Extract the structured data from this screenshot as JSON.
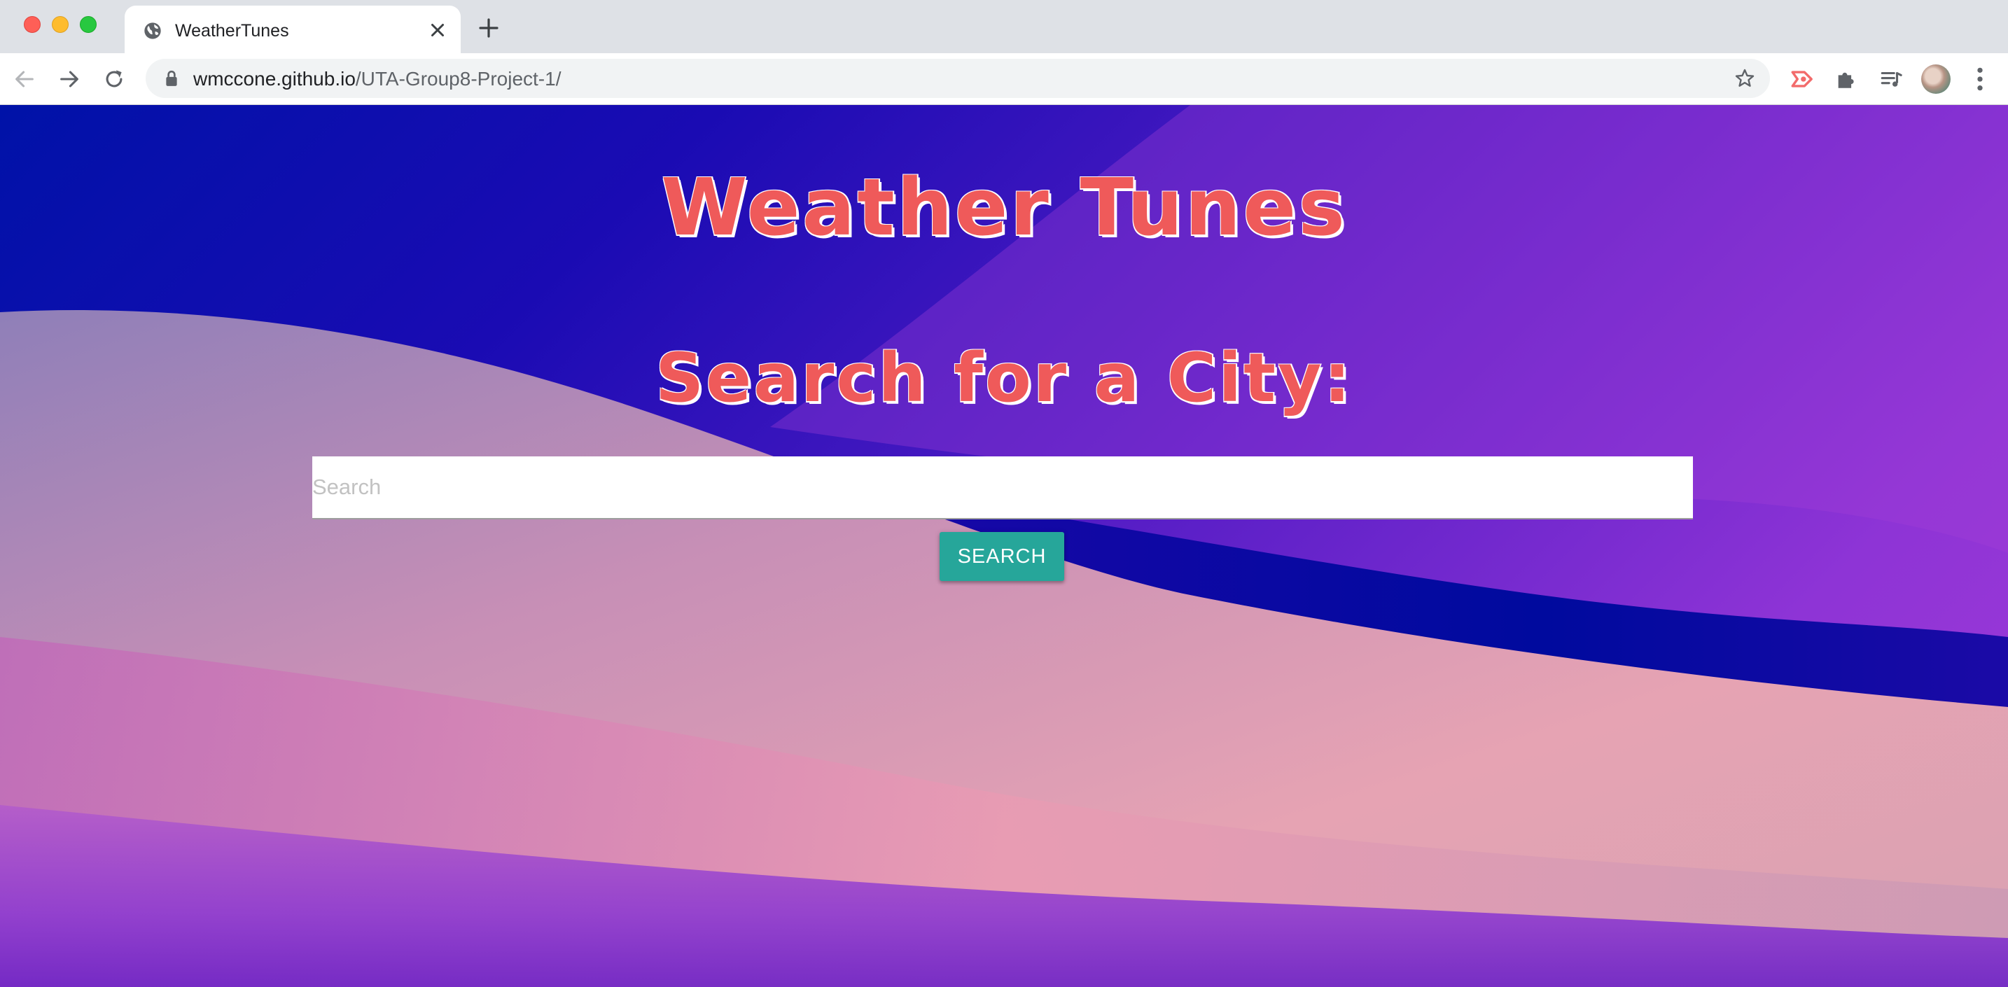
{
  "browser": {
    "tab": {
      "title": "WeatherTunes",
      "favicon": "globe-icon"
    },
    "toolbar": {
      "url_host": "wmccone.github.io",
      "url_path": "/UTA-Group8-Project-1/"
    },
    "icons": [
      "back-icon",
      "forward-icon",
      "reload-icon",
      "lock-icon",
      "star-icon",
      "cast-extension-icon",
      "puzzle-extension-icon",
      "media-control-icon",
      "menu-dots-icon",
      "close-icon",
      "plus-icon"
    ]
  },
  "page": {
    "title": "Weather Tunes",
    "search_heading": "Search for a City:",
    "search": {
      "placeholder": "Search",
      "value": "",
      "button_label": "SEARCH"
    },
    "colors": {
      "heading": "#ef5a5a",
      "button": "#26a69a"
    }
  }
}
